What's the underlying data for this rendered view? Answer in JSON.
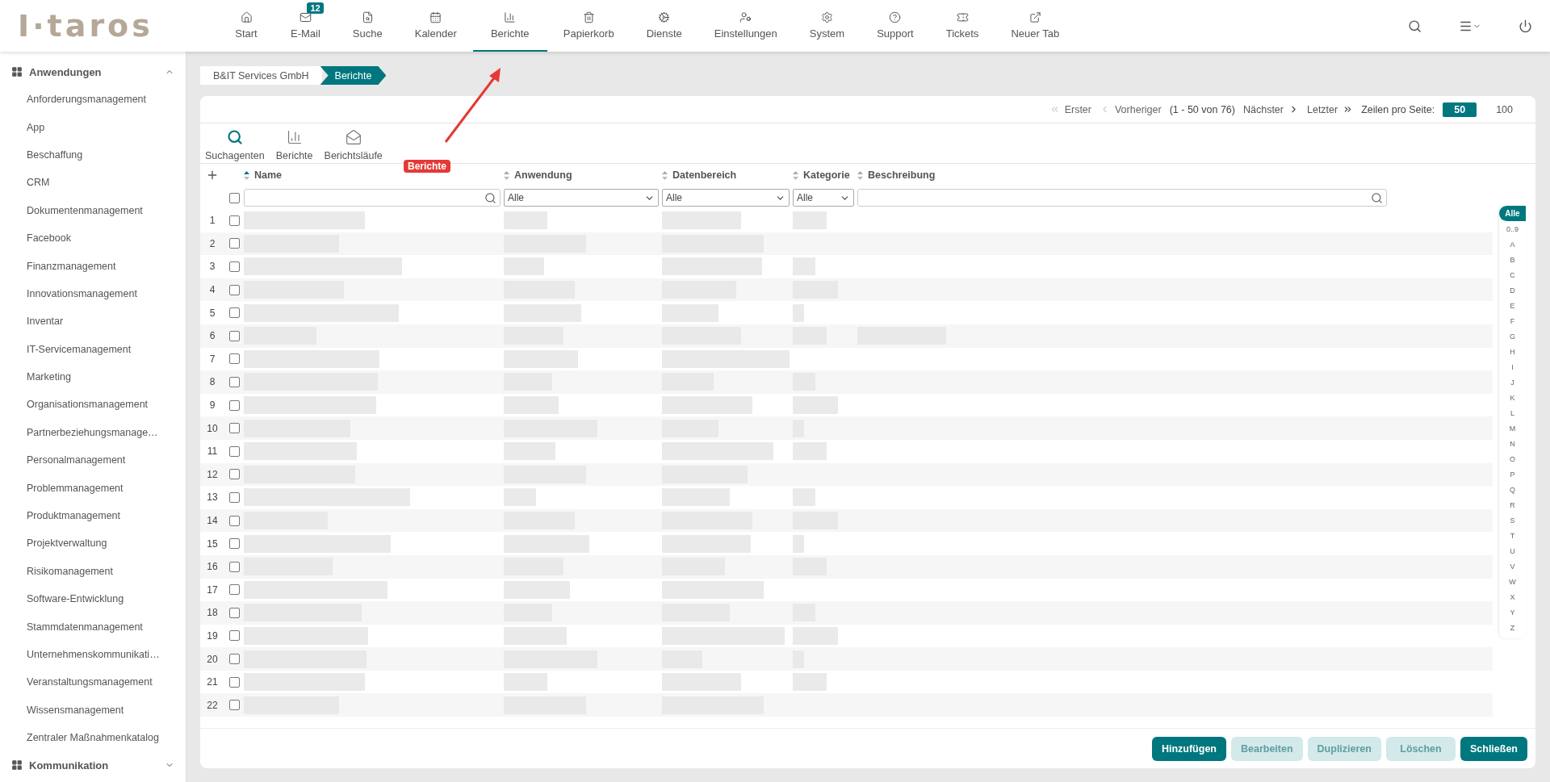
{
  "logo": {
    "text": "I·taros"
  },
  "nav": [
    {
      "label": "Start",
      "selected": false
    },
    {
      "label": "E-Mail",
      "badge": "12",
      "selected": false
    },
    {
      "label": "Suche",
      "selected": false
    },
    {
      "label": "Kalender",
      "selected": false
    },
    {
      "label": "Berichte",
      "selected": true
    },
    {
      "label": "Papierkorb",
      "selected": false
    },
    {
      "label": "Dienste",
      "selected": false
    },
    {
      "label": "Einstellungen",
      "selected": false
    },
    {
      "label": "System",
      "selected": false
    },
    {
      "label": "Support",
      "selected": false
    },
    {
      "label": "Tickets",
      "selected": false
    },
    {
      "label": "Neuer Tab",
      "selected": false
    }
  ],
  "sidebar": {
    "groups": [
      {
        "label": "Anwendungen",
        "expanded": true,
        "items": [
          "Anforderungsmanagement",
          "App",
          "Beschaffung",
          "CRM",
          "Dokumentenmanagement",
          "Facebook",
          "Finanzmanagement",
          "Innovationsmanagement",
          "Inventar",
          "IT-Servicemanagement",
          "Marketing",
          "Organisationsmanagement",
          "Partnerbeziehungsmanage…",
          "Personalmanagement",
          "Problemmanagement",
          "Produktmanagement",
          "Projektverwaltung",
          "Risikomanagement",
          "Software-Entwicklung",
          "Stammdatenmanagement",
          "Unternehmenskommunikati…",
          "Veranstaltungsmanagement",
          "Wissensmanagement",
          "Zentraler Maßnahmenkatalog"
        ]
      },
      {
        "label": "Kommunikation",
        "expanded": false
      }
    ]
  },
  "breadcrumb": [
    "B&IT Services GmbH",
    "Berichte"
  ],
  "pagination": {
    "first": {
      "label": "Erster",
      "disabled": true
    },
    "previous": {
      "label": "Vorheriger",
      "disabled": true
    },
    "range": "(1 - 50 von 76)",
    "next": {
      "label": "Nächster",
      "disabled": false
    },
    "last": {
      "label": "Letzter",
      "disabled": false
    },
    "rows_label": "Zeilen pro Seite:",
    "page_sizes": [
      {
        "label": "50",
        "selected": true
      },
      {
        "label": "100",
        "selected": false
      }
    ]
  },
  "toolbar": [
    {
      "label": "Suchagenten",
      "selected": true
    },
    {
      "label": "Berichte",
      "selected": false
    },
    {
      "label": "Berichtsläufe",
      "selected": false
    }
  ],
  "annotation": {
    "label": "Berichte"
  },
  "table": {
    "select_all": {
      "checked": false
    },
    "columns": [
      {
        "label": "Name",
        "sorted": true,
        "filter": {
          "kind": "search"
        }
      },
      {
        "label": "Anwendung",
        "sorted": false,
        "filter": {
          "kind": "select",
          "value": "Alle"
        }
      },
      {
        "label": "Datenbereich",
        "sorted": false,
        "filter": {
          "kind": "select",
          "value": "Alle"
        }
      },
      {
        "label": "Kategorie",
        "sorted": false,
        "filter": {
          "kind": "select",
          "value": "Alle"
        }
      },
      {
        "label": "Beschreibung",
        "sorted": false,
        "filter": {
          "kind": "search"
        }
      }
    ],
    "rows": [
      {
        "number": "1",
        "checked": false
      },
      {
        "number": "2",
        "checked": false
      },
      {
        "number": "3",
        "checked": false
      },
      {
        "number": "4",
        "checked": false
      },
      {
        "number": "5",
        "checked": false
      },
      {
        "number": "6",
        "checked": false
      },
      {
        "number": "7",
        "checked": false
      },
      {
        "number": "8",
        "checked": false
      },
      {
        "number": "9",
        "checked": false
      },
      {
        "number": "10",
        "checked": false
      },
      {
        "number": "11",
        "checked": false
      },
      {
        "number": "12",
        "checked": false
      },
      {
        "number": "13",
        "checked": false
      },
      {
        "number": "14",
        "checked": false
      },
      {
        "number": "15",
        "checked": false
      },
      {
        "number": "16",
        "checked": false
      },
      {
        "number": "17",
        "checked": false
      },
      {
        "number": "18",
        "checked": false
      },
      {
        "number": "19",
        "checked": false
      },
      {
        "number": "20",
        "checked": false
      },
      {
        "number": "21",
        "checked": false
      },
      {
        "number": "22",
        "checked": false
      }
    ]
  },
  "alphabet": [
    {
      "label": "Alle",
      "selected": true
    },
    {
      "label": "0..9",
      "selected": false
    },
    {
      "label": "A",
      "selected": false
    },
    {
      "label": "B",
      "selected": false
    },
    {
      "label": "C",
      "selected": false
    },
    {
      "label": "D",
      "selected": false
    },
    {
      "label": "E",
      "selected": false
    },
    {
      "label": "F",
      "selected": false
    },
    {
      "label": "G",
      "selected": false
    },
    {
      "label": "H",
      "selected": false
    },
    {
      "label": "I",
      "selected": false
    },
    {
      "label": "J",
      "selected": false
    },
    {
      "label": "K",
      "selected": false
    },
    {
      "label": "L",
      "selected": false
    },
    {
      "label": "M",
      "selected": false
    },
    {
      "label": "N",
      "selected": false
    },
    {
      "label": "O",
      "selected": false
    },
    {
      "label": "P",
      "selected": false
    },
    {
      "label": "Q",
      "selected": false
    },
    {
      "label": "R",
      "selected": false
    },
    {
      "label": "S",
      "selected": false
    },
    {
      "label": "T",
      "selected": false
    },
    {
      "label": "U",
      "selected": false
    },
    {
      "label": "V",
      "selected": false
    },
    {
      "label": "W",
      "selected": false
    },
    {
      "label": "X",
      "selected": false
    },
    {
      "label": "Y",
      "selected": false
    },
    {
      "label": "Z",
      "selected": false
    }
  ],
  "buttons": [
    {
      "label": "Hinzufügen",
      "disabled": false
    },
    {
      "label": "Bearbeiten",
      "disabled": true
    },
    {
      "label": "Duplizieren",
      "disabled": true
    },
    {
      "label": "Löschen",
      "disabled": true
    },
    {
      "label": "Schließen",
      "disabled": false
    }
  ]
}
